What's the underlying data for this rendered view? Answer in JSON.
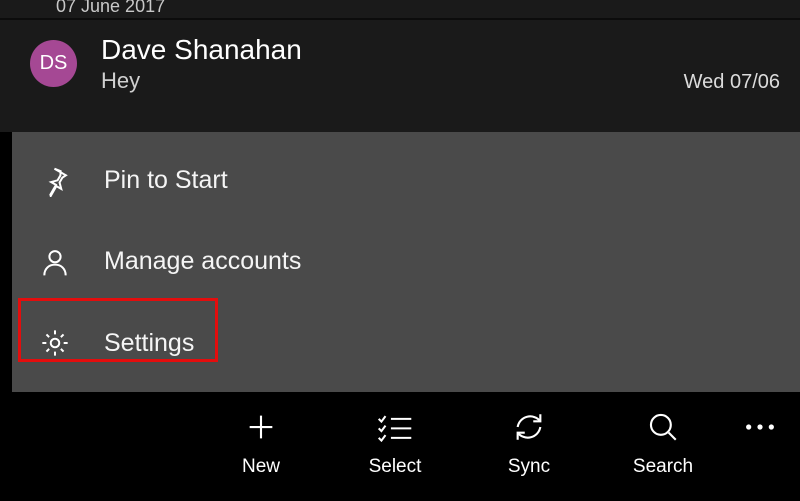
{
  "header_date": "07 June 2017",
  "message": {
    "avatar_initials": "DS",
    "avatar_color": "#a54894",
    "sender": "Dave Shanahan",
    "subject": "Hey",
    "timestamp": "Wed 07/06"
  },
  "context_menu": [
    {
      "icon": "pin",
      "label": "Pin to Start"
    },
    {
      "icon": "person",
      "label": "Manage accounts"
    },
    {
      "icon": "gear",
      "label": "Settings"
    }
  ],
  "highlighted_menu_index": 2,
  "bottom_bar": {
    "new": "New",
    "select": "Select",
    "sync": "Sync",
    "search": "Search"
  }
}
